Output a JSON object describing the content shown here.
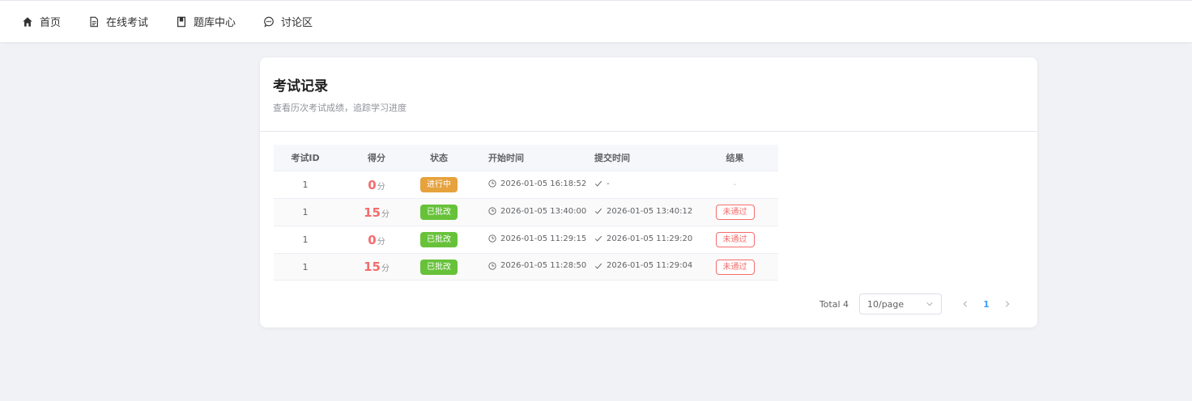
{
  "nav": {
    "items": [
      {
        "label": "首页",
        "icon": "home-icon"
      },
      {
        "label": "在线考试",
        "icon": "document-icon"
      },
      {
        "label": "题库中心",
        "icon": "book-icon"
      },
      {
        "label": "讨论区",
        "icon": "chat-icon"
      }
    ]
  },
  "card": {
    "title": "考试记录",
    "subtitle": "查看历次考试成绩，追踪学习进度"
  },
  "table": {
    "headers": {
      "id": "考试ID",
      "score": "得分",
      "status": "状态",
      "start": "开始时间",
      "submit": "提交时间",
      "result": "结果"
    },
    "score_unit": "分",
    "rows": [
      {
        "id": "1",
        "score": "0",
        "status": "进行中",
        "status_type": "warning",
        "start": "2026-01-05 16:18:52",
        "submit": "-",
        "result": "-"
      },
      {
        "id": "1",
        "score": "15",
        "status": "已批改",
        "status_type": "success",
        "start": "2026-01-05 13:40:00",
        "submit": "2026-01-05 13:40:12",
        "result": "未通过"
      },
      {
        "id": "1",
        "score": "0",
        "status": "已批改",
        "status_type": "success",
        "start": "2026-01-05 11:29:15",
        "submit": "2026-01-05 11:29:20",
        "result": "未通过"
      },
      {
        "id": "1",
        "score": "15",
        "status": "已批改",
        "status_type": "success",
        "start": "2026-01-05 11:28:50",
        "submit": "2026-01-05 11:29:04",
        "result": "未通过"
      }
    ]
  },
  "pagination": {
    "total": "Total 4",
    "page_size": "10/page",
    "current_page": "1"
  },
  "colors": {
    "accent": "#409eff",
    "danger": "#f56c6c",
    "warning": "#e6a23c",
    "success": "#67c23a"
  }
}
